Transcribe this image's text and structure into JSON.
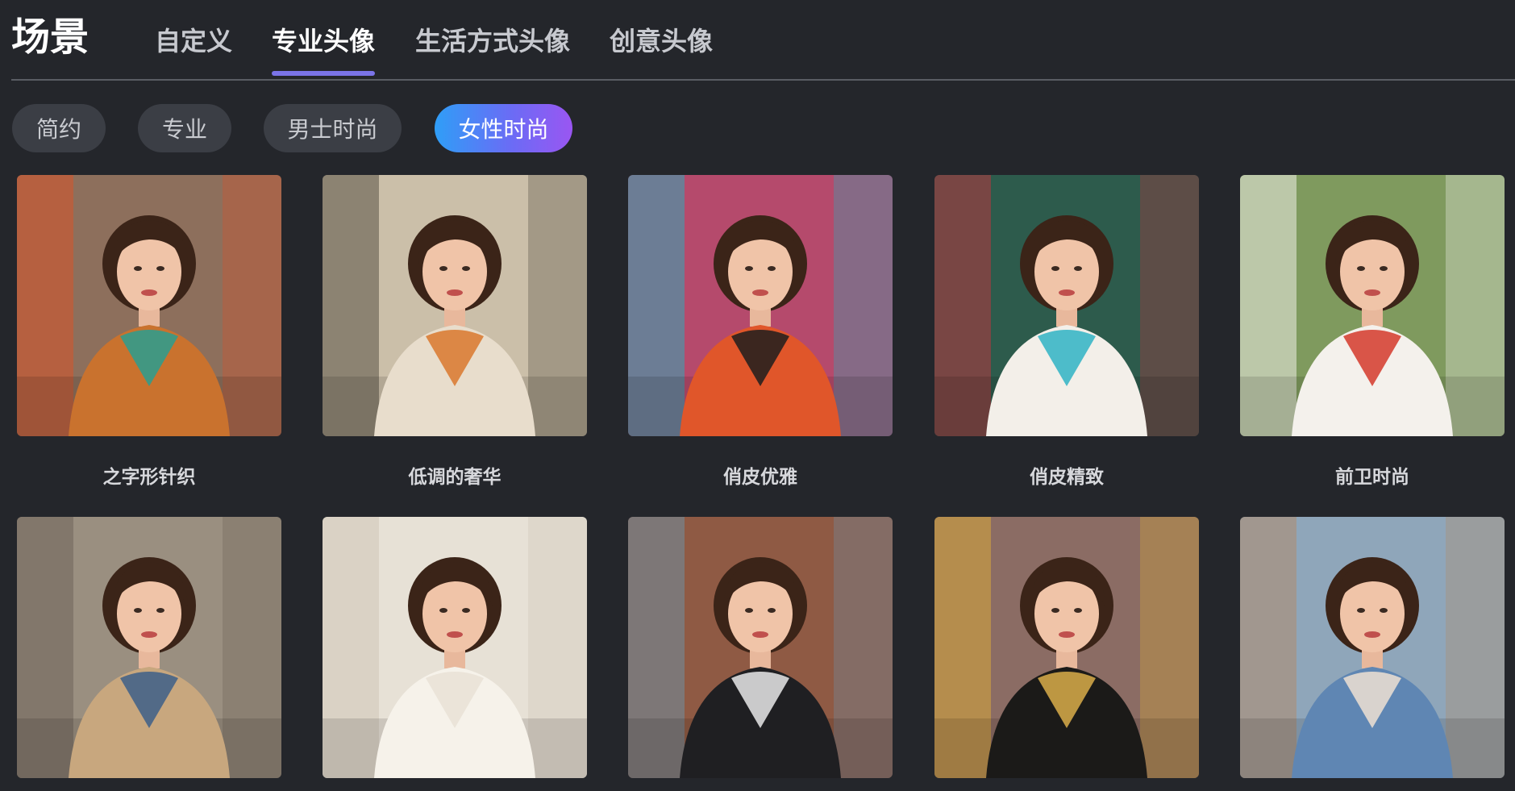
{
  "header": {
    "title": "场景",
    "tabs": [
      {
        "label": "自定义",
        "active": false
      },
      {
        "label": "专业头像",
        "active": true
      },
      {
        "label": "生活方式头像",
        "active": false
      },
      {
        "label": "创意头像",
        "active": false
      }
    ]
  },
  "filters": [
    {
      "label": "简约",
      "active": false
    },
    {
      "label": "专业",
      "active": false
    },
    {
      "label": "男士时尚",
      "active": false
    },
    {
      "label": "女性时尚",
      "active": true
    }
  ],
  "colors": {
    "background": "#24262b",
    "chip": "#3b3e45",
    "accent_start": "#2f9ef7",
    "accent_end": "#9a56f2",
    "tab_underline": "#7b74e8"
  },
  "grid": {
    "items": [
      {
        "label": "之字形针织",
        "scene": "colorful painted wall street, zigzag knit top",
        "bg": "#8d6f5c",
        "accent": "#d8532a",
        "outfit": "#c9722e",
        "outfit2": "#2a9d8f"
      },
      {
        "label": "低调的奢华",
        "scene": "classic building street, cream blouse with orange scarf",
        "bg": "#cbbfa9",
        "accent": "#5a5246",
        "outfit": "#e8ddcc",
        "outfit2": "#d9782d"
      },
      {
        "label": "俏皮优雅",
        "scene": "graffiti wall street, patterned orange dress",
        "bg": "#b54a6c",
        "accent": "#2fa7b8",
        "outfit": "#e0562a",
        "outfit2": "#1d1d1d"
      },
      {
        "label": "俏皮精致",
        "scene": "boutique storefront, floral ruffle dress",
        "bg": "#2d5b4c",
        "accent": "#b8343e",
        "outfit": "#f3efe9",
        "outfit2": "#2fb3c4"
      },
      {
        "label": "前卫时尚",
        "scene": "garden terrace, white floral blazer",
        "bg": "#7f9a5e",
        "accent": "#efeee8",
        "outfit": "#f4f1ec",
        "outfit2": "#d33a2c"
      },
      {
        "label": "",
        "scene": "european street, trench coat and denim jacket",
        "bg": "#9a8f80",
        "accent": "#6f655a",
        "outfit": "#c8a77e",
        "outfit2": "#3d5f88"
      },
      {
        "label": "",
        "scene": "white ornate interior, bridal lace dress and veil",
        "bg": "#e7e1d6",
        "accent": "#cfc6b8",
        "outfit": "#f6f2ea",
        "outfit2": "#e9e2d6"
      },
      {
        "label": "",
        "scene": "brick building and construction crane, black leather jacket",
        "bg": "#8f5a44",
        "accent": "#6f8fa3",
        "outfit": "#1f1f22",
        "outfit2": "#e9e9e9"
      },
      {
        "label": "",
        "scene": "golden column hall, black and gold dress",
        "bg": "#8b6c64",
        "accent": "#d8a93a",
        "outfit": "#1b1a18",
        "outfit2": "#d9ae4a"
      },
      {
        "label": "",
        "scene": "city skyline rooftop, blue blazer",
        "bg": "#8fa6ba",
        "accent": "#b08b6b",
        "outfit": "#5f86b3",
        "outfit2": "#efe1d2"
      }
    ]
  }
}
